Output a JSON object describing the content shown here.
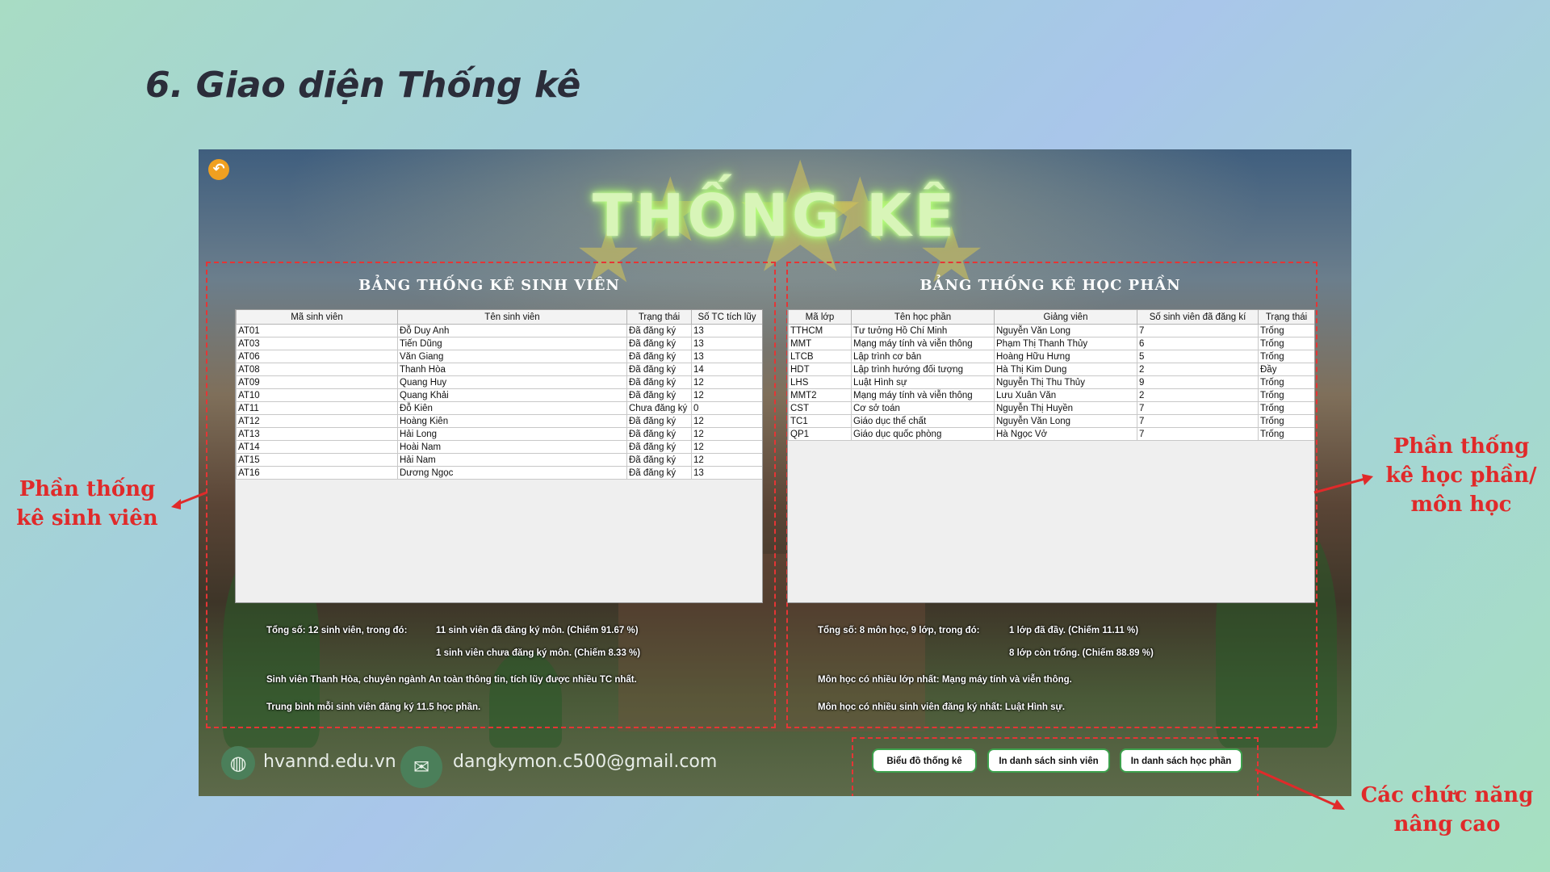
{
  "slide": {
    "title": "6. Giao diện Thống kê"
  },
  "app": {
    "title": "THỐNG KÊ"
  },
  "student_panel": {
    "heading": "BẢNG THỐNG KÊ SINH VIÊN",
    "columns": [
      "Mã sinh viên",
      "Tên sinh viên",
      "Trạng thái",
      "Số TC tích lũy"
    ],
    "rows": [
      [
        "AT01",
        "Đỗ Duy Anh",
        "Đã đăng ký",
        "13"
      ],
      [
        "AT03",
        "Tiến Dũng",
        "Đã đăng ký",
        "13"
      ],
      [
        "AT06",
        "Văn Giang",
        "Đã đăng ký",
        "13"
      ],
      [
        "AT08",
        "Thanh Hòa",
        "Đã đăng ký",
        "14"
      ],
      [
        "AT09",
        "Quang Huy",
        "Đã đăng ký",
        "12"
      ],
      [
        "AT10",
        "Quang Khải",
        "Đã đăng ký",
        "12"
      ],
      [
        "AT11",
        "Đỗ Kiên",
        "Chưa đăng ký",
        "0"
      ],
      [
        "AT12",
        "Hoàng Kiên",
        "Đã đăng ký",
        "12"
      ],
      [
        "AT13",
        "Hải Long",
        "Đã đăng ký",
        "12"
      ],
      [
        "AT14",
        "Hoài Nam",
        "Đã đăng ký",
        "12"
      ],
      [
        "AT15",
        "Hải Nam",
        "Đã đăng ký",
        "12"
      ],
      [
        "AT16",
        "Dương Ngọc",
        "Đã đăng ký",
        "13"
      ]
    ],
    "stats": {
      "total": "Tổng số: 12 sinh viên, trong đó:",
      "registered": "11 sinh viên đã đăng ký môn. (Chiếm 91.67 %)",
      "unregistered": "1 sinh viên chưa đăng ký môn. (Chiếm 8.33 %)",
      "top_student": "Sinh viên Thanh Hòa, chuyên ngành An toàn thông tin, tích lũy được nhiều TC nhất.",
      "average": "Trung bình mỗi sinh viên đăng ký 11.5 học phần."
    }
  },
  "course_panel": {
    "heading": "BẢNG THỐNG KÊ HỌC PHẦN",
    "columns": [
      "Mã lớp",
      "Tên học phần",
      "Giảng viên",
      "Số sinh viên đã đăng kí",
      "Trạng thái"
    ],
    "rows": [
      [
        "TTHCM",
        "Tư tưởng Hồ Chí Minh",
        "Nguyễn Văn Long",
        "7",
        "Trống"
      ],
      [
        "MMT",
        "Mạng máy tính và viễn thông",
        "Phạm Thị Thanh Thủy",
        "6",
        "Trống"
      ],
      [
        "LTCB",
        "Lập trình cơ bản",
        "Hoàng Hữu Hưng",
        "5",
        "Trống"
      ],
      [
        "HDT",
        "Lập trình hướng đối tượng",
        "Hà Thị Kim Dung",
        "2",
        "Đầy"
      ],
      [
        "LHS",
        "Luật Hình sự",
        "Nguyễn Thị Thu Thủy",
        "9",
        "Trống"
      ],
      [
        "MMT2",
        "Mạng máy tính và viễn thông",
        "Lưu Xuân Văn",
        "2",
        "Trống"
      ],
      [
        "CST",
        "Cơ sở toán",
        "Nguyễn Thị Huyền",
        "7",
        "Trống"
      ],
      [
        "TC1",
        "Giáo dục thể chất",
        "Nguyễn Văn Long",
        "7",
        "Trống"
      ],
      [
        "QP1",
        "Giáo dục quốc phòng",
        "Hà Ngọc Vở",
        "7",
        "Trống"
      ]
    ],
    "stats": {
      "total": "Tổng số: 8 môn học, 9 lớp, trong đó:",
      "full": "1 lớp đã đầy. (Chiếm 11.11 %)",
      "open": "8 lớp còn trống. (Chiếm 88.89 %)",
      "most_classes": "Môn học có nhiều lớp nhất: Mạng máy tính và viễn thông.",
      "most_students": "Môn học có nhiều sinh viên đăng ký nhất: Luật Hình sự."
    }
  },
  "footer": {
    "website": "hvannd.edu.vn",
    "email": "dangkymon.c500@gmail.com"
  },
  "buttons": {
    "chart": "Biểu đồ thống kê",
    "print_students": "In danh sách sinh viên",
    "print_courses": "In danh sách học phần"
  },
  "annotations": {
    "students_line1": "Phần thống",
    "students_line2": "kê sinh viên",
    "courses_line1": "Phần thống",
    "courses_line2": "kê học phần/",
    "courses_line3": "môn học",
    "advanced_line1": "Các chức năng",
    "advanced_line2": "nâng cao"
  },
  "icons": {
    "back": "back-arrow-icon",
    "globe": "globe-icon",
    "mail": "mail-icon"
  },
  "colors": {
    "annotation_red": "#e02a2a",
    "button_border": "#3da04c",
    "title_glow": "#b6ff7a"
  }
}
